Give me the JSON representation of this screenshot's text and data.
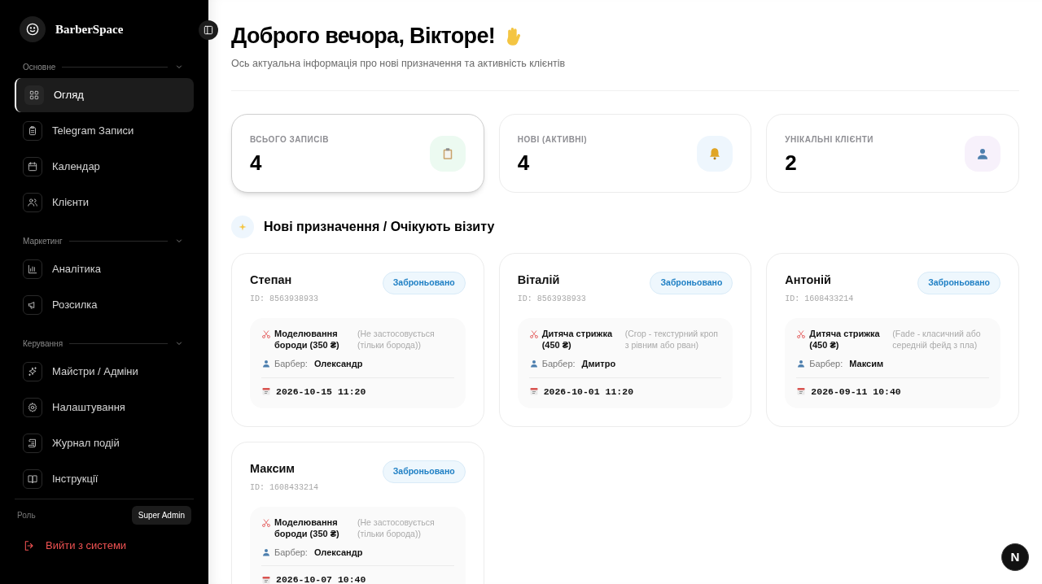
{
  "sidebar": {
    "brand": "BarberSpace",
    "sections": [
      {
        "title": "Основне",
        "expanded": true,
        "items": [
          {
            "label": "Огляд",
            "kind": "grid",
            "selected": true
          },
          {
            "label": "Telegram Записи",
            "kind": "clipboard",
            "selected": false
          },
          {
            "label": "Календар",
            "kind": "calendar",
            "selected": false
          },
          {
            "label": "Клієнти",
            "kind": "users",
            "selected": false
          }
        ]
      },
      {
        "title": "Маркетинг",
        "expanded": true,
        "items": [
          {
            "label": "Аналітика",
            "kind": "chart",
            "selected": false
          },
          {
            "label": "Розсилка",
            "kind": "megaphone",
            "selected": false
          }
        ]
      },
      {
        "title": "Керування",
        "expanded": true,
        "items": [
          {
            "label": "Майстри / Адміни",
            "kind": "sparkles",
            "selected": false
          },
          {
            "label": "Налаштування",
            "kind": "gear",
            "selected": false
          },
          {
            "label": "Журнал подій",
            "kind": "scroll",
            "selected": false
          },
          {
            "label": "Інструкції",
            "kind": "book",
            "selected": false
          }
        ]
      }
    ],
    "role_label": "Роль",
    "role": "Super Admin",
    "logout": "Вийти з системи"
  },
  "greeting": {
    "title": "Доброго вечора, Вікторе!",
    "subtitle": "Ось актуальна інформація про нові призначення та активність клієнтів"
  },
  "stats": [
    {
      "label": "ВСЬОГО ЗАПИСІВ",
      "value": "4",
      "kind": "clipboard",
      "selected": true
    },
    {
      "label": "НОВІ (АКТИВНІ)",
      "value": "4",
      "kind": "bell",
      "selected": false
    },
    {
      "label": "УНІКАЛЬНІ КЛІЄНТИ",
      "value": "2",
      "kind": "user",
      "selected": false
    }
  ],
  "section_title": "Нові призначення / Очікують візиту",
  "appointments": [
    {
      "name": "Степан",
      "id": "ID: 8563938933",
      "status": "Заброньовано",
      "service": "Моделювання бороди (350 ₴)",
      "note": "(Не застосовується (тільки борода))",
      "barber_label": "Барбер:",
      "barber": "Олександр",
      "datetime": "2026-10-15 11:20"
    },
    {
      "name": "Віталій",
      "id": "ID: 8563938933",
      "status": "Заброньовано",
      "service": "Дитяча стрижка (450 ₴)",
      "note": "(Crop - текстурний кроп з рівним або рван)",
      "barber_label": "Барбер:",
      "barber": "Дмитро",
      "datetime": "2026-10-01 11:20"
    },
    {
      "name": "Антоній",
      "id": "ID: 1608433214",
      "status": "Заброньовано",
      "service": "Дитяча стрижка (450 ₴)",
      "note": "(Fade - класичний або середній фейд з пла)",
      "barber_label": "Барбер:",
      "barber": "Максим",
      "datetime": "2026-09-11 10:40"
    },
    {
      "name": "Максим",
      "id": "ID: 1608433214",
      "status": "Заброньовано",
      "service": "Моделювання бороди (350 ₴)",
      "note": "(Не застосовується (тільки борода))",
      "barber_label": "Барбер:",
      "barber": "Олександр",
      "datetime": "2026-10-07 10:40"
    }
  ],
  "fab": "N"
}
